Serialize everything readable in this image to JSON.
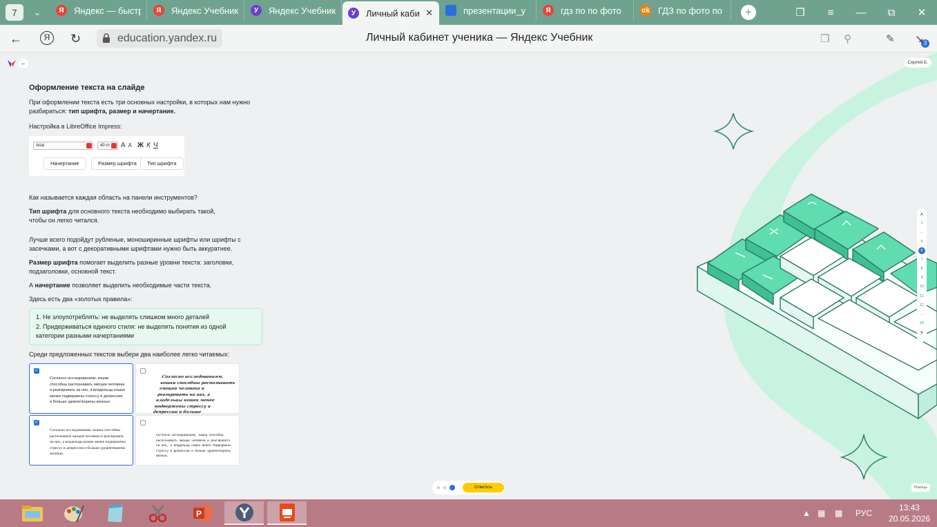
{
  "browser": {
    "tab_count": "7",
    "tabs": [
      {
        "title": "Яндекс — быстр",
        "icon": "yandex-icon",
        "color": "#e8433a"
      },
      {
        "title": "Яндекс Учебник",
        "icon": "yandex-icon",
        "color": "#e8433a"
      },
      {
        "title": "Яндекс Учебник",
        "icon": "yandex-uchebnik-icon",
        "color": "#6a3fd1"
      },
      {
        "title": "Личный каби",
        "icon": "yandex-uchebnik-icon",
        "color": "#6a3fd1",
        "active": true
      },
      {
        "title": "презентации_у",
        "icon": "docs-icon",
        "color": "#2a6fdb"
      },
      {
        "title": "гдз по по фото",
        "icon": "yandex-icon",
        "color": "#e8433a"
      },
      {
        "title": "ГДЗ по фото по",
        "icon": "ok-icon",
        "color": "#ee8208"
      }
    ],
    "url": "education.yandex.ru",
    "page_title": "Личный кабинет ученика — Яндекс Учебник",
    "downloads_badge": "3"
  },
  "page": {
    "user": "Сергей Б.",
    "heading": "Оформление текста на слайде",
    "intro": "При оформлении текста есть три основных настройки, в которых нам нужно разбираться: ",
    "intro_bold": "тип шрифта, размер и начертание.",
    "libre_label": "Настройка в LibreOffice Impress:",
    "toolbar": {
      "font_name": "Arial",
      "font_size": "40 пт",
      "icons": [
        "A",
        "A",
        "Ж",
        "К",
        "Ч"
      ],
      "label_style": "Начертание",
      "label_size": "Размер шрифта",
      "label_type": "Тип шрифта"
    },
    "question": "Как называется каждая область на панели инструментов?",
    "p1_bold": "Тип шрифта",
    "p1": " для основного текста необходимо выбирать такой, чтобы он легко читался.",
    "p2": "Лучше всего подойдут рубленые, моноширинные шрифты или шрифты с засечками, а вот с декоративными шрифтами нужно быть аккуратнее.",
    "p3_bold": "Размер шрифта",
    "p3": " помогает выделить разные уровни текста: заголовки, подзаголовки, основной текст.",
    "p4_pre": "А ",
    "p4_bold": "начертание",
    "p4": " позволяет выделить необходимые части текста.",
    "p5": "Здесь есть два «золотых правила»:",
    "rule1": "1. Не злоупотреблять: не выделять слишком много деталей",
    "rule2": "2. Придерживаться единого стиля: не выделять понятия из одной категории разными начертаниями",
    "task": "Среди предложенных текстов выбери два наиболее легко читаемых:",
    "card_text": "Согласно исследованиям, кошки способны распознавать эмоции человека и реагировать на них, а владельцы кошек менее подвержены стрессу и депрессии и больше удовлетворены жизнью.",
    "cards_checked": [
      true,
      false,
      true,
      false
    ],
    "pager": [
      "1",
      "...",
      "5",
      "6",
      "7",
      "8",
      "9",
      "10",
      "11",
      "12",
      "...",
      "15"
    ],
    "current_page": "6",
    "answer_button": "Ответить",
    "help": "Помощь"
  },
  "taskbar": {
    "lang": "РУС",
    "time": "13:43",
    "date": "20.05.2026"
  },
  "colors": {
    "tabstrip": "#6fa390",
    "accent": "#2f6fd6",
    "answer": "#ffcc00",
    "taskbar": "#b87b86",
    "mint": "#5fdcb0"
  }
}
